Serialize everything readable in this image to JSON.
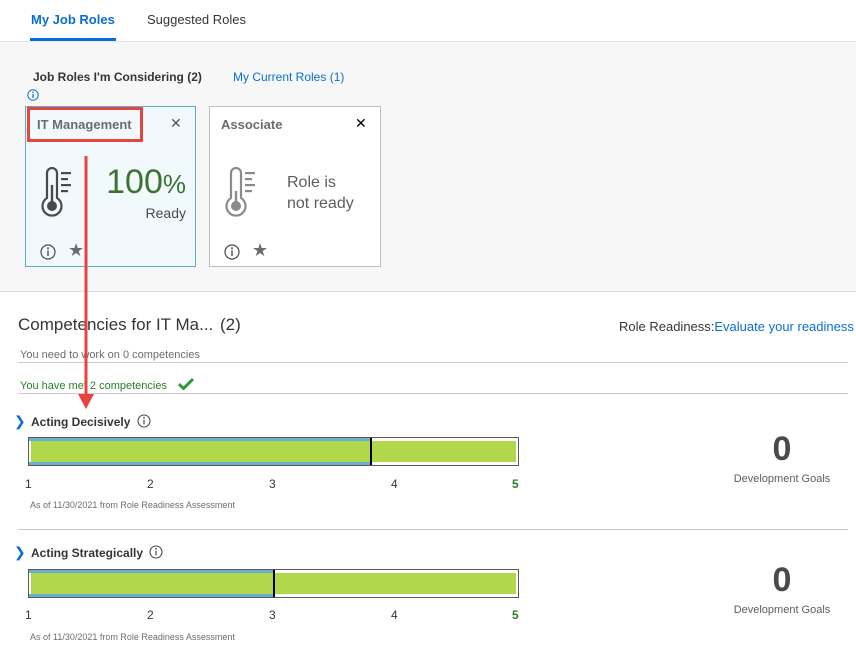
{
  "tabs": [
    {
      "label": "My Job Roles"
    },
    {
      "label": "Suggested Roles"
    }
  ],
  "role_panel": {
    "considering_label": "Job Roles I'm Considering (2)",
    "current_roles_label": "My Current Roles (1)"
  },
  "cards": [
    {
      "title": "IT Management",
      "percent": "100",
      "percent_symbol": "%",
      "status": "Ready",
      "readiness_percent": 100
    },
    {
      "title": "Associate",
      "status_line1": "Role is",
      "status_line2": "not ready"
    }
  ],
  "competencies": {
    "title": "Competencies for IT Ma...",
    "count": "(2)",
    "readiness_label": "Role Readiness:",
    "readiness_link": "Evaluate your readiness",
    "need_work": "You need to work on 0 competencies",
    "have_met": "You have met 2 competencies",
    "items": [
      {
        "name": "Acting Decisively",
        "ticks": [
          "1",
          "2",
          "3",
          "4",
          "5"
        ],
        "fill_value": 5,
        "rating": 3.8,
        "as_of": "As of 11/30/2021 from Role Readiness Assessment",
        "goals": "0",
        "goals_label": "Development Goals"
      },
      {
        "name": "Acting Strategically",
        "ticks": [
          "1",
          "2",
          "3",
          "4",
          "5"
        ],
        "fill_value": 5,
        "rating": 3.0,
        "as_of": "As of 11/30/2021 from Role Readiness Assessment",
        "goals": "0",
        "goals_label": "Development Goals"
      }
    ]
  },
  "colors": {
    "accent": "#0a6ed1",
    "ready_green": "#3d7332",
    "bar_fill": "#b1d84a",
    "highlight": "#e8443f"
  }
}
